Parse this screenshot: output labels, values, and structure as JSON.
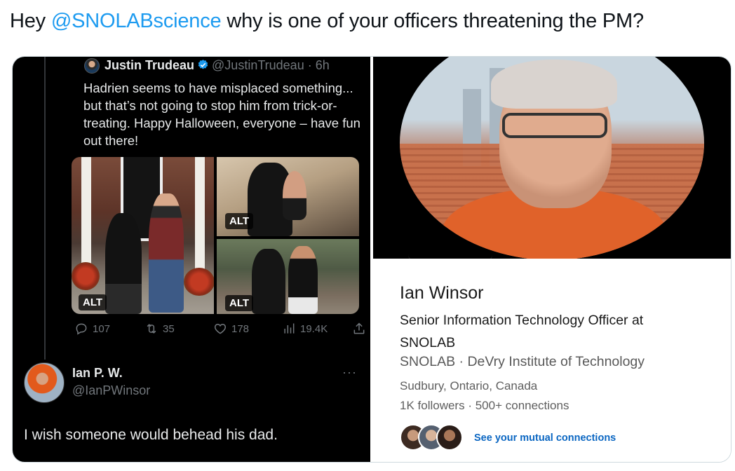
{
  "tweet": {
    "prefix": "Hey ",
    "mention": "@SNOLABscience",
    "suffix": " why is one of your officers threatening the PM?",
    "accent": "#1d9bf0"
  },
  "quoted_tweet": {
    "name": "Justin Trudeau",
    "handle": "@JustinTrudeau · 6h",
    "verified_icon": "verified-badge-icon",
    "body": "Hadrien seems to have misplaced something... but that’s not going to stop him from trick-or-treating. Happy Halloween, everyone – have fun out there!",
    "alt_label": "ALT",
    "metrics": {
      "replies": "107",
      "reposts": "35",
      "likes": "178",
      "views": "19.4K"
    }
  },
  "reply": {
    "name": "Ian P. W.",
    "handle": "@IanPWinsor",
    "more": "···",
    "text": "I wish someone would behead his dad."
  },
  "linkedin": {
    "name": "Ian Winsor",
    "headline": "Senior Information Technology Officer at SNOLAB",
    "org1": "SNOLAB",
    "separator": " · ",
    "org2": "DeVry Institute of Technology",
    "location": "Sudbury, Ontario, Canada",
    "followers": "1K followers",
    "stat_separator": " · ",
    "connections": "500+ connections",
    "mutual_link": "See your mutual connections",
    "link_color": "#0a66c2"
  }
}
